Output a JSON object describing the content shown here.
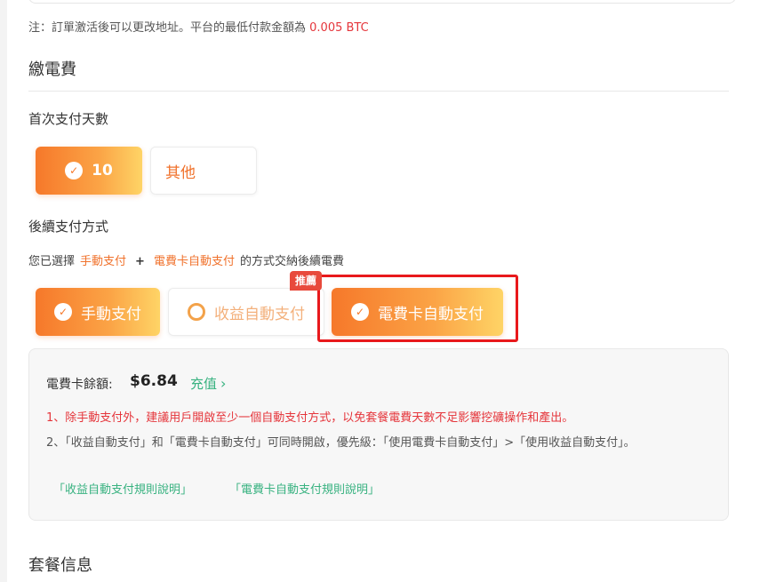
{
  "note": {
    "text": "注：訂單激活後可以更改地址。平台的最低付款金額為",
    "amount": "0.005 BTC"
  },
  "section_title": "繳電費",
  "first_payment": {
    "label": "首次支付天數",
    "options": [
      {
        "label": "10",
        "selected": true
      },
      {
        "label": "其他",
        "selected": false
      }
    ]
  },
  "subsequent": {
    "label": "後續支付方式",
    "desc_prefix": "您已選擇",
    "selected_1": "手動支付",
    "plus": "+",
    "selected_2": "電費卡自動支付",
    "desc_suffix": "的方式交納後續電費",
    "badge": "推薦",
    "options": [
      {
        "label": "手動支付",
        "selected": true
      },
      {
        "label": "收益自動支付",
        "selected": false
      },
      {
        "label": "電費卡自動支付",
        "selected": true
      }
    ]
  },
  "info": {
    "balance_label": "電費卡餘額:",
    "balance_value": "$6.84",
    "recharge_label": "充值",
    "warning": "1、除手動支付外，建議用戶開啟至少一個自動支付方式，以免套餐電費天數不足影響挖礦操作和產出。",
    "priority": "2、「收益自動支付」和「電費卡自動支付」可同時開啟，優先級：「使用電費卡自動支付」>「使用收益自動支付」。",
    "link_1": "「收益自動支付規則說明」",
    "link_2": "「電費卡自動支付規則說明」"
  },
  "bottom_title": "套餐信息",
  "colors": {
    "accent_orange": "#f6782a",
    "accent_yellow": "#fed466",
    "link_green": "#38b280",
    "warning_red": "#e5353b",
    "highlight_red": "#e8191c"
  }
}
